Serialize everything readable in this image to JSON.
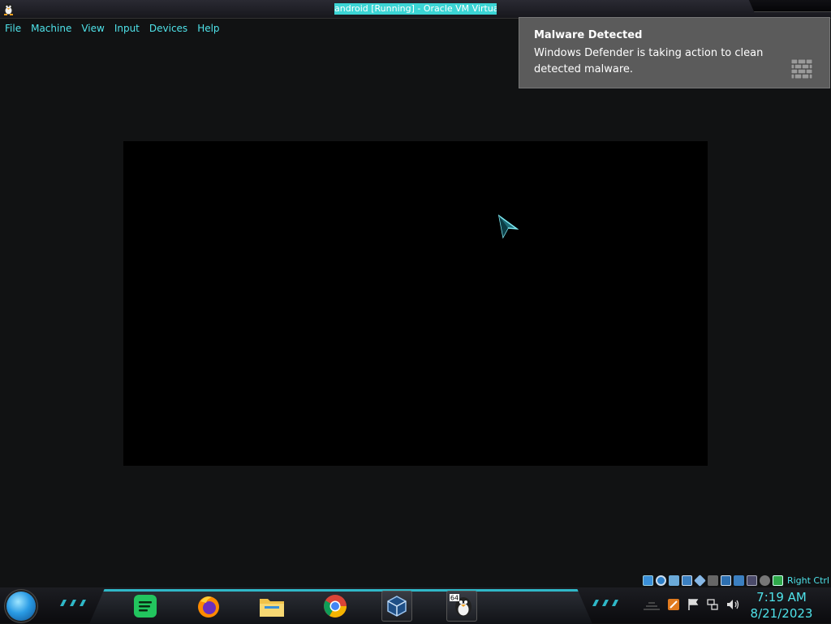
{
  "window": {
    "title": "android [Running] - Oracle VM VirtualBox"
  },
  "menu": {
    "items": [
      "File",
      "Machine",
      "View",
      "Input",
      "Devices",
      "Help"
    ]
  },
  "notification": {
    "title": "Malware Detected",
    "body": "Windows Defender is taking action to clean detected malware.",
    "icon": "brick-wall-icon"
  },
  "vbox_status": {
    "host_key_label": "Right Ctrl",
    "indicators": [
      "hard-disk-icon",
      "optical-drive-icon",
      "audio-icon",
      "network-icon",
      "usb-icon",
      "shared-folders-icon",
      "display-icon",
      "recording-icon",
      "virtualization-icon",
      "mouse-integration-icon",
      "host-key-icon"
    ]
  },
  "taskbar": {
    "apps": [
      {
        "name": "spotify-icon"
      },
      {
        "name": "firefox-icon"
      },
      {
        "name": "file-explorer-icon"
      },
      {
        "name": "chrome-icon"
      },
      {
        "name": "virtualbox-icon"
      },
      {
        "name": "virtualbox-vm-icon",
        "badge": "64"
      }
    ],
    "tray_icons": [
      "tray-app-icon",
      "action-center-flag-icon",
      "network-tray-icon",
      "volume-icon"
    ]
  },
  "clock": {
    "time": "7:19 AM",
    "date": "8/21/2023"
  },
  "colors": {
    "accent": "#4fe3ea",
    "title_highlight": "#3bd5d5",
    "toast_bg": "#5b5b5b",
    "desktop_bg": "#111213"
  }
}
